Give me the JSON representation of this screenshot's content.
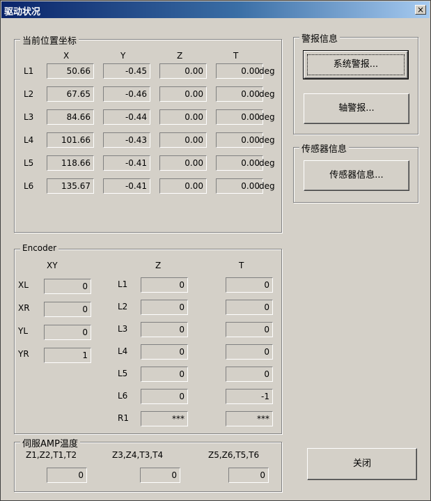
{
  "window": {
    "title": "驱动状况",
    "close_symbol": "×"
  },
  "position_group": {
    "title": "当前位置坐标",
    "columns": [
      "X",
      "Y",
      "Z",
      "T"
    ],
    "rows": [
      {
        "label": "L1",
        "x": "50.66",
        "y": "-0.45",
        "z": "0.00",
        "t": "0.00",
        "unit": "deg"
      },
      {
        "label": "L2",
        "x": "67.65",
        "y": "-0.46",
        "z": "0.00",
        "t": "0.00",
        "unit": "deg"
      },
      {
        "label": "L3",
        "x": "84.66",
        "y": "-0.44",
        "z": "0.00",
        "t": "0.00",
        "unit": "deg"
      },
      {
        "label": "L4",
        "x": "101.66",
        "y": "-0.43",
        "z": "0.00",
        "t": "0.00",
        "unit": "deg"
      },
      {
        "label": "L5",
        "x": "118.66",
        "y": "-0.41",
        "z": "0.00",
        "t": "0.00",
        "unit": "deg"
      },
      {
        "label": "L6",
        "x": "135.67",
        "y": "-0.41",
        "z": "0.00",
        "t": "0.00",
        "unit": "deg"
      }
    ]
  },
  "alarm_group": {
    "title": "警报信息",
    "system_alarm_button": "系统警报...",
    "axis_alarm_button": "轴警报..."
  },
  "sensor_group": {
    "title": "传感器信息",
    "sensor_button": "传感器信息..."
  },
  "encoder_group": {
    "title": "Encoder",
    "xy_header": "XY",
    "z_header": "Z",
    "t_header": "T",
    "xy_rows": [
      {
        "label": "XL",
        "value": "0"
      },
      {
        "label": "XR",
        "value": "0"
      },
      {
        "label": "YL",
        "value": "0"
      },
      {
        "label": "YR",
        "value": "1"
      }
    ],
    "zt_rows": [
      {
        "label": "L1",
        "z": "0",
        "t": "0"
      },
      {
        "label": "L2",
        "z": "0",
        "t": "0"
      },
      {
        "label": "L3",
        "z": "0",
        "t": "0"
      },
      {
        "label": "L4",
        "z": "0",
        "t": "0"
      },
      {
        "label": "L5",
        "z": "0",
        "t": "0"
      },
      {
        "label": "L6",
        "z": "0",
        "t": "-1"
      },
      {
        "label": "R1",
        "z": "***",
        "t": "***"
      }
    ]
  },
  "amp_group": {
    "title": "伺服AMP温度",
    "col1_label": "Z1,Z2,T1,T2",
    "col1_value": "0",
    "col2_label": "Z3,Z4,T3,T4",
    "col2_value": "0",
    "col3_label": "Z5,Z6,T5,T6",
    "col3_value": "0"
  },
  "close_button": "关闭"
}
